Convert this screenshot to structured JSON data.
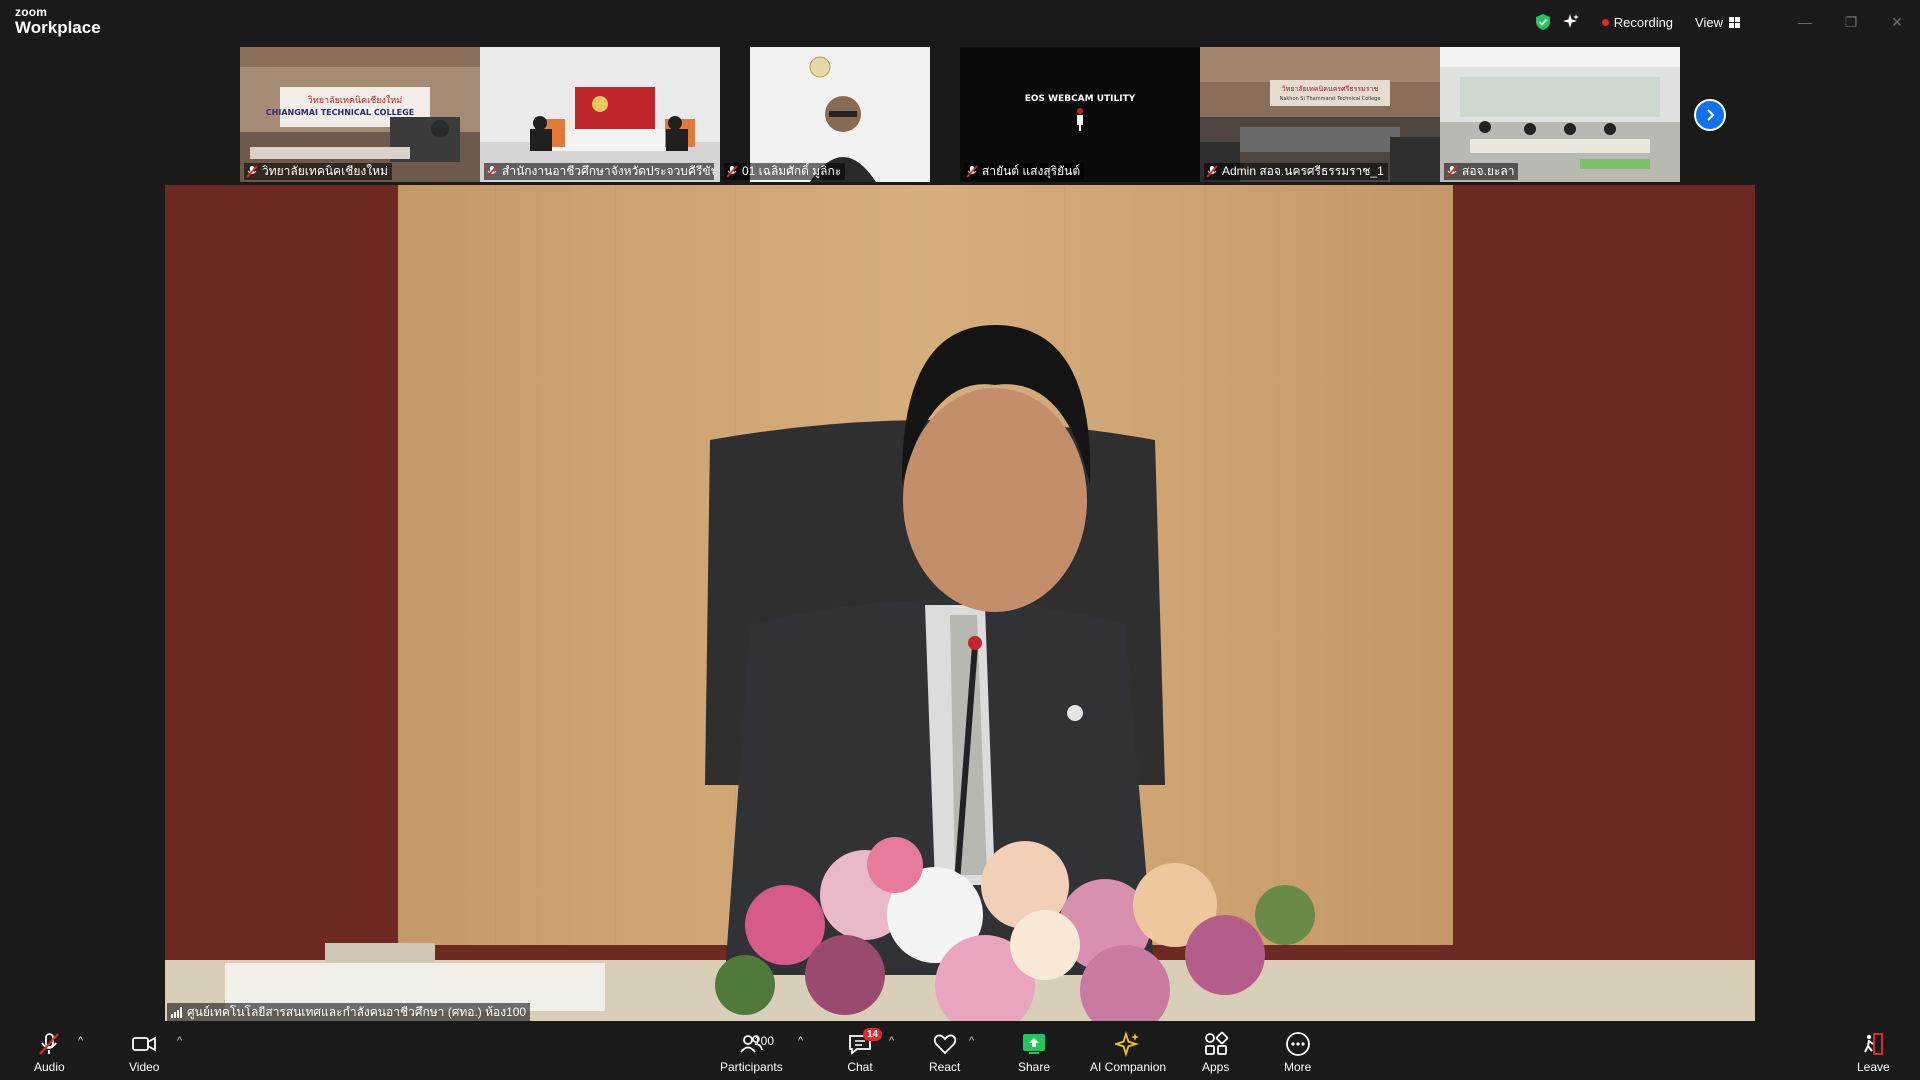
{
  "app": {
    "brand_small": "zoom",
    "brand_name": "Workplace"
  },
  "titlebar": {
    "recording_label": "Recording",
    "view_label": "View"
  },
  "thumbnails": [
    {
      "name": "วิทยาลัยเทคนิคเชียงใหม่",
      "scene_text": "CHIANGMAI TECHNICAL COLLEGE",
      "scene_text2": "วิทยาลัยเทคนิคเชียงใหม่"
    },
    {
      "name": "สำนักงานอาชีวศึกษาจังหวัดประจวบคีรีขันธ์"
    },
    {
      "name": "01 เฉลิมศักดิ์ มูลิกะ"
    },
    {
      "name": "สายันต์ แสงสุริยันต์",
      "scene_text": "EOS WEBCAM UTILITY"
    },
    {
      "name": "Admin สอจ.นครศรีธรรมราช_1",
      "scene_text": "วิทยาลัยเทคนิคนครศรีธรรมราช",
      "scene_text2": "Nakhon Si Thammarat Technical College"
    },
    {
      "name": "สอจ.ยะลา"
    }
  ],
  "main_video": {
    "speaker_label": "ศูนย์เทคโนโลยีสารสนเทศและกำลังคนอาชีวศึกษา (ศทอ.) ห้อง100"
  },
  "toolbar": {
    "audio": "Audio",
    "video": "Video",
    "participants": "Participants",
    "participants_count": "100",
    "chat": "Chat",
    "chat_badge": "14",
    "react": "React",
    "share": "Share",
    "ai_companion": "AI Companion",
    "apps": "Apps",
    "more": "More",
    "leave": "Leave"
  },
  "colors": {
    "accent": "#0e72ed",
    "recording": "#e02828",
    "share": "#23c55e",
    "ai": "#f5c518",
    "shield": "#22c55e"
  }
}
